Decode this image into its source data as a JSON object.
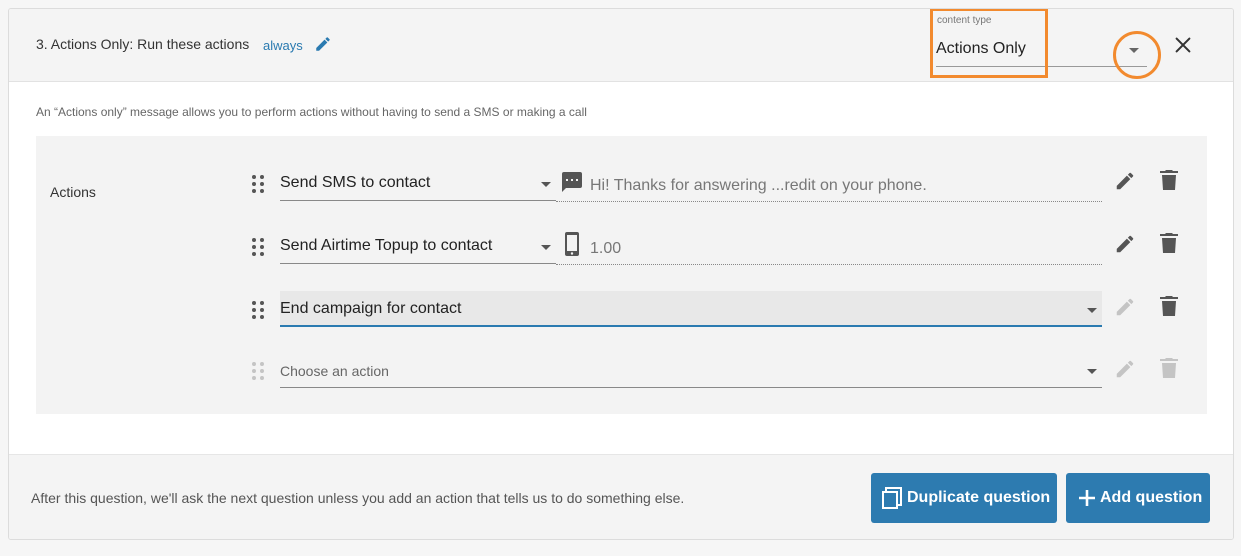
{
  "question": {
    "title": "3. Actions Only: Run these actions",
    "condition": "always",
    "edit_icon": "pencil-icon"
  },
  "content_type": {
    "label": "content type",
    "value": "Actions Only",
    "arrow_icon": "caret-down-icon",
    "close_icon": "close-icon"
  },
  "description": "An “Actions only” message allows you to perform actions without having to send a SMS or making a call",
  "actions_section": {
    "label": "Actions",
    "rows": [
      {
        "action": "Send SMS to contact",
        "param_icon": "message-icon",
        "param_value": "Hi! Thanks for answering ...redit on your phone.",
        "edit_enabled": true,
        "delete_enabled": true
      },
      {
        "action": "Send Airtime Topup to contact",
        "param_icon": "phone-icon",
        "param_value": "1.00",
        "edit_enabled": true,
        "delete_enabled": true
      },
      {
        "action": "End campaign for contact",
        "edit_enabled": false,
        "delete_enabled": true
      },
      {
        "placeholder": "Choose an action",
        "edit_enabled": false,
        "delete_enabled": false
      }
    ]
  },
  "footer": {
    "text": "After this question, we'll ask the next question unless you add an action that tells us to do something else.",
    "duplicate_label": "Duplicate question",
    "add_label": "Add question"
  },
  "colors": {
    "accent": "#2d7bb0",
    "highlight": "#f28a2e",
    "link": "#2a7ab0"
  }
}
